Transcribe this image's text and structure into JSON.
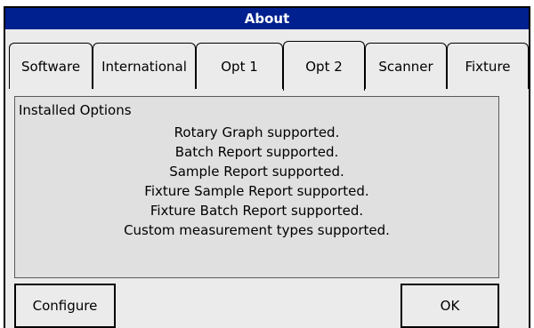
{
  "window": {
    "title": "About"
  },
  "tabs": [
    {
      "label": "Software"
    },
    {
      "label": "International"
    },
    {
      "label": "Opt 1"
    },
    {
      "label": "Opt 2"
    },
    {
      "label": "Scanner"
    },
    {
      "label": "Fixture"
    }
  ],
  "active_tab": "Opt 2",
  "panel": {
    "heading": "Installed Options",
    "lines": [
      "Rotary Graph supported.",
      "Batch Report supported.",
      "Sample Report supported.",
      "Fixture Sample Report supported.",
      "Fixture Batch Report supported.",
      "Custom measurement types supported."
    ]
  },
  "buttons": {
    "configure": "Configure",
    "ok": "OK"
  },
  "colors": {
    "titlebar": "#00208f",
    "titlebar_text": "#ffffff",
    "background": "#ebebeb",
    "panel": "#e0e0e0"
  }
}
